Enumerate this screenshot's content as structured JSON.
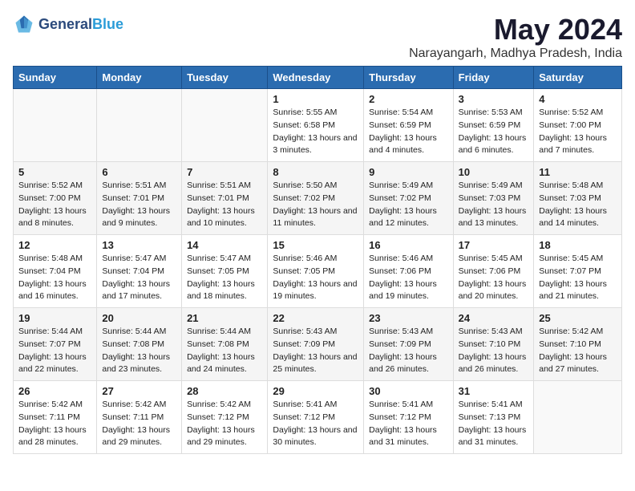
{
  "header": {
    "logo_general": "General",
    "logo_blue": "Blue",
    "month_year": "May 2024",
    "location": "Narayangarh, Madhya Pradesh, India"
  },
  "weekdays": [
    "Sunday",
    "Monday",
    "Tuesday",
    "Wednesday",
    "Thursday",
    "Friday",
    "Saturday"
  ],
  "weeks": [
    [
      {
        "day": "",
        "sunrise": "",
        "sunset": "",
        "daylight": ""
      },
      {
        "day": "",
        "sunrise": "",
        "sunset": "",
        "daylight": ""
      },
      {
        "day": "",
        "sunrise": "",
        "sunset": "",
        "daylight": ""
      },
      {
        "day": "1",
        "sunrise": "Sunrise: 5:55 AM",
        "sunset": "Sunset: 6:58 PM",
        "daylight": "Daylight: 13 hours and 3 minutes."
      },
      {
        "day": "2",
        "sunrise": "Sunrise: 5:54 AM",
        "sunset": "Sunset: 6:59 PM",
        "daylight": "Daylight: 13 hours and 4 minutes."
      },
      {
        "day": "3",
        "sunrise": "Sunrise: 5:53 AM",
        "sunset": "Sunset: 6:59 PM",
        "daylight": "Daylight: 13 hours and 6 minutes."
      },
      {
        "day": "4",
        "sunrise": "Sunrise: 5:52 AM",
        "sunset": "Sunset: 7:00 PM",
        "daylight": "Daylight: 13 hours and 7 minutes."
      }
    ],
    [
      {
        "day": "5",
        "sunrise": "Sunrise: 5:52 AM",
        "sunset": "Sunset: 7:00 PM",
        "daylight": "Daylight: 13 hours and 8 minutes."
      },
      {
        "day": "6",
        "sunrise": "Sunrise: 5:51 AM",
        "sunset": "Sunset: 7:01 PM",
        "daylight": "Daylight: 13 hours and 9 minutes."
      },
      {
        "day": "7",
        "sunrise": "Sunrise: 5:51 AM",
        "sunset": "Sunset: 7:01 PM",
        "daylight": "Daylight: 13 hours and 10 minutes."
      },
      {
        "day": "8",
        "sunrise": "Sunrise: 5:50 AM",
        "sunset": "Sunset: 7:02 PM",
        "daylight": "Daylight: 13 hours and 11 minutes."
      },
      {
        "day": "9",
        "sunrise": "Sunrise: 5:49 AM",
        "sunset": "Sunset: 7:02 PM",
        "daylight": "Daylight: 13 hours and 12 minutes."
      },
      {
        "day": "10",
        "sunrise": "Sunrise: 5:49 AM",
        "sunset": "Sunset: 7:03 PM",
        "daylight": "Daylight: 13 hours and 13 minutes."
      },
      {
        "day": "11",
        "sunrise": "Sunrise: 5:48 AM",
        "sunset": "Sunset: 7:03 PM",
        "daylight": "Daylight: 13 hours and 14 minutes."
      }
    ],
    [
      {
        "day": "12",
        "sunrise": "Sunrise: 5:48 AM",
        "sunset": "Sunset: 7:04 PM",
        "daylight": "Daylight: 13 hours and 16 minutes."
      },
      {
        "day": "13",
        "sunrise": "Sunrise: 5:47 AM",
        "sunset": "Sunset: 7:04 PM",
        "daylight": "Daylight: 13 hours and 17 minutes."
      },
      {
        "day": "14",
        "sunrise": "Sunrise: 5:47 AM",
        "sunset": "Sunset: 7:05 PM",
        "daylight": "Daylight: 13 hours and 18 minutes."
      },
      {
        "day": "15",
        "sunrise": "Sunrise: 5:46 AM",
        "sunset": "Sunset: 7:05 PM",
        "daylight": "Daylight: 13 hours and 19 minutes."
      },
      {
        "day": "16",
        "sunrise": "Sunrise: 5:46 AM",
        "sunset": "Sunset: 7:06 PM",
        "daylight": "Daylight: 13 hours and 19 minutes."
      },
      {
        "day": "17",
        "sunrise": "Sunrise: 5:45 AM",
        "sunset": "Sunset: 7:06 PM",
        "daylight": "Daylight: 13 hours and 20 minutes."
      },
      {
        "day": "18",
        "sunrise": "Sunrise: 5:45 AM",
        "sunset": "Sunset: 7:07 PM",
        "daylight": "Daylight: 13 hours and 21 minutes."
      }
    ],
    [
      {
        "day": "19",
        "sunrise": "Sunrise: 5:44 AM",
        "sunset": "Sunset: 7:07 PM",
        "daylight": "Daylight: 13 hours and 22 minutes."
      },
      {
        "day": "20",
        "sunrise": "Sunrise: 5:44 AM",
        "sunset": "Sunset: 7:08 PM",
        "daylight": "Daylight: 13 hours and 23 minutes."
      },
      {
        "day": "21",
        "sunrise": "Sunrise: 5:44 AM",
        "sunset": "Sunset: 7:08 PM",
        "daylight": "Daylight: 13 hours and 24 minutes."
      },
      {
        "day": "22",
        "sunrise": "Sunrise: 5:43 AM",
        "sunset": "Sunset: 7:09 PM",
        "daylight": "Daylight: 13 hours and 25 minutes."
      },
      {
        "day": "23",
        "sunrise": "Sunrise: 5:43 AM",
        "sunset": "Sunset: 7:09 PM",
        "daylight": "Daylight: 13 hours and 26 minutes."
      },
      {
        "day": "24",
        "sunrise": "Sunrise: 5:43 AM",
        "sunset": "Sunset: 7:10 PM",
        "daylight": "Daylight: 13 hours and 26 minutes."
      },
      {
        "day": "25",
        "sunrise": "Sunrise: 5:42 AM",
        "sunset": "Sunset: 7:10 PM",
        "daylight": "Daylight: 13 hours and 27 minutes."
      }
    ],
    [
      {
        "day": "26",
        "sunrise": "Sunrise: 5:42 AM",
        "sunset": "Sunset: 7:11 PM",
        "daylight": "Daylight: 13 hours and 28 minutes."
      },
      {
        "day": "27",
        "sunrise": "Sunrise: 5:42 AM",
        "sunset": "Sunset: 7:11 PM",
        "daylight": "Daylight: 13 hours and 29 minutes."
      },
      {
        "day": "28",
        "sunrise": "Sunrise: 5:42 AM",
        "sunset": "Sunset: 7:12 PM",
        "daylight": "Daylight: 13 hours and 29 minutes."
      },
      {
        "day": "29",
        "sunrise": "Sunrise: 5:41 AM",
        "sunset": "Sunset: 7:12 PM",
        "daylight": "Daylight: 13 hours and 30 minutes."
      },
      {
        "day": "30",
        "sunrise": "Sunrise: 5:41 AM",
        "sunset": "Sunset: 7:12 PM",
        "daylight": "Daylight: 13 hours and 31 minutes."
      },
      {
        "day": "31",
        "sunrise": "Sunrise: 5:41 AM",
        "sunset": "Sunset: 7:13 PM",
        "daylight": "Daylight: 13 hours and 31 minutes."
      },
      {
        "day": "",
        "sunrise": "",
        "sunset": "",
        "daylight": ""
      }
    ]
  ]
}
